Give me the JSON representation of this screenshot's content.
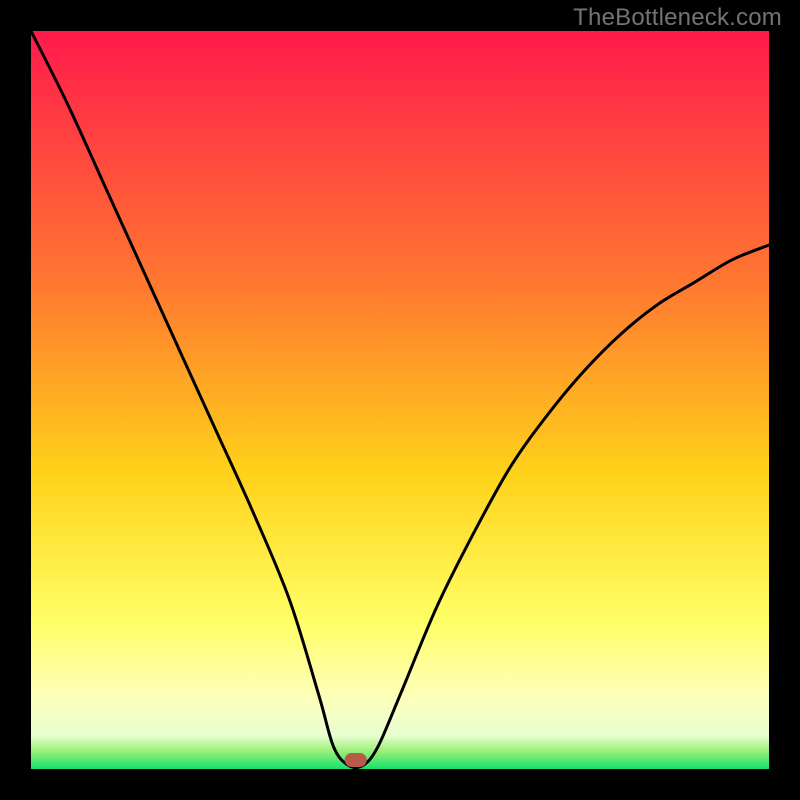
{
  "watermark": "TheBottleneck.com",
  "chart_data": {
    "type": "line",
    "title": "",
    "xlabel": "",
    "ylabel": "",
    "xlim": [
      0,
      100
    ],
    "ylim": [
      0,
      100
    ],
    "grid": false,
    "series": [
      {
        "name": "bottleneck-curve",
        "x": [
          0,
          5,
          10,
          15,
          20,
          25,
          30,
          35,
          39,
          41,
          43,
          45,
          47,
          50,
          55,
          60,
          65,
          70,
          75,
          80,
          85,
          90,
          95,
          100
        ],
        "values": [
          100,
          90,
          79,
          68,
          57,
          46,
          35,
          23,
          10,
          3,
          0.5,
          0.5,
          3,
          10,
          22,
          32,
          41,
          48,
          54,
          59,
          63,
          66,
          69,
          71
        ]
      }
    ],
    "marker": {
      "x_percent": 44,
      "color": "#b85a4a"
    },
    "gradient_stops": [
      {
        "offset": 0,
        "color": "#ff1a4b"
      },
      {
        "offset": 0.35,
        "color": "#ff7a30"
      },
      {
        "offset": 0.6,
        "color": "#ffd21a"
      },
      {
        "offset": 0.8,
        "color": "#ffff66"
      },
      {
        "offset": 0.9,
        "color": "#fdffb8"
      },
      {
        "offset": 0.955,
        "color": "#e8ffd0"
      },
      {
        "offset": 0.975,
        "color": "#9cf07a"
      },
      {
        "offset": 1.0,
        "color": "#16e06a"
      }
    ]
  }
}
